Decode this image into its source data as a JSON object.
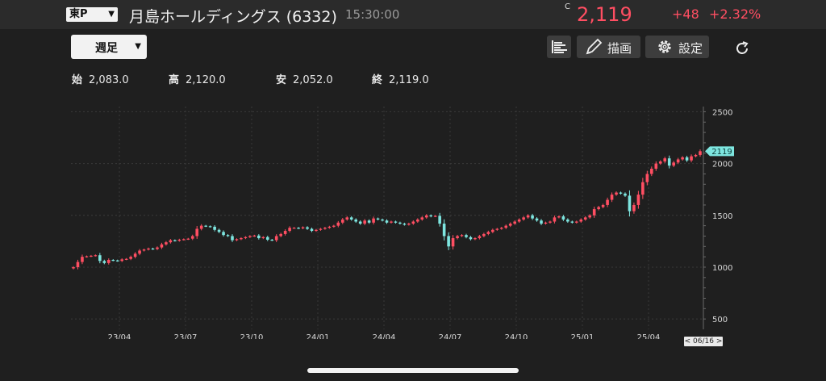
{
  "header": {
    "market": "東P",
    "stock_name": "月島ホールディングス",
    "code": "(6332)",
    "time": "15:30:00",
    "price_flag": "C",
    "price": "2,119",
    "change": "+48",
    "change_pct": "+2.32%",
    "up_color": "#ff4e62"
  },
  "toolbar": {
    "period": "週足",
    "draw_label": "描画",
    "settings_label": "設定",
    "icons": [
      "chart-type-icon",
      "pen-icon",
      "gear-icon",
      "refresh-icon"
    ]
  },
  "ohlc": {
    "open_label": "始",
    "open": "2,083.0",
    "high_label": "高",
    "high": "2,120.0",
    "low_label": "安",
    "low": "2,052.0",
    "close_label": "終",
    "close": "2,119.0"
  },
  "chart_data": {
    "type": "candlestick",
    "interval": "weekly",
    "y_ticks": [
      "2500",
      "2000",
      "1500",
      "1000",
      "500"
    ],
    "ylim": [
      400,
      2550
    ],
    "x_ticks": [
      "23/04",
      "23/07",
      "23/10",
      "24/01",
      "24/04",
      "24/07",
      "24/10",
      "25/01",
      "25/04"
    ],
    "last_price_label": "2119",
    "date_badge": "< 06/16 >",
    "up_color": "#ff4e62",
    "down_color": "#7ee6e0",
    "close_series": [
      1000,
      1050,
      1100,
      1105,
      1110,
      1115,
      1060,
      1040,
      1070,
      1065,
      1060,
      1075,
      1080,
      1100,
      1130,
      1160,
      1170,
      1180,
      1175,
      1190,
      1220,
      1240,
      1260,
      1255,
      1265,
      1270,
      1275,
      1300,
      1370,
      1400,
      1395,
      1390,
      1360,
      1340,
      1310,
      1300,
      1260,
      1270,
      1280,
      1290,
      1300,
      1305,
      1280,
      1290,
      1265,
      1260,
      1300,
      1320,
      1350,
      1380,
      1380,
      1375,
      1385,
      1370,
      1350,
      1360,
      1370,
      1380,
      1390,
      1400,
      1430,
      1460,
      1480,
      1460,
      1440,
      1420,
      1450,
      1430,
      1470,
      1460,
      1450,
      1430,
      1440,
      1430,
      1420,
      1410,
      1420,
      1440,
      1460,
      1480,
      1500,
      1490,
      1495,
      1420,
      1300,
      1200,
      1280,
      1300,
      1310,
      1290,
      1270,
      1280,
      1300,
      1320,
      1340,
      1360,
      1370,
      1380,
      1400,
      1420,
      1440,
      1460,
      1480,
      1500,
      1470,
      1450,
      1420,
      1430,
      1440,
      1480,
      1490,
      1460,
      1440,
      1430,
      1440,
      1460,
      1480,
      1500,
      1560,
      1580,
      1600,
      1650,
      1700,
      1720,
      1710,
      1690,
      1540,
      1600,
      1700,
      1820,
      1900,
      1950,
      2000,
      2020,
      2050,
      1980,
      2010,
      2040,
      2060,
      2030,
      2070,
      2083,
      2119
    ]
  }
}
